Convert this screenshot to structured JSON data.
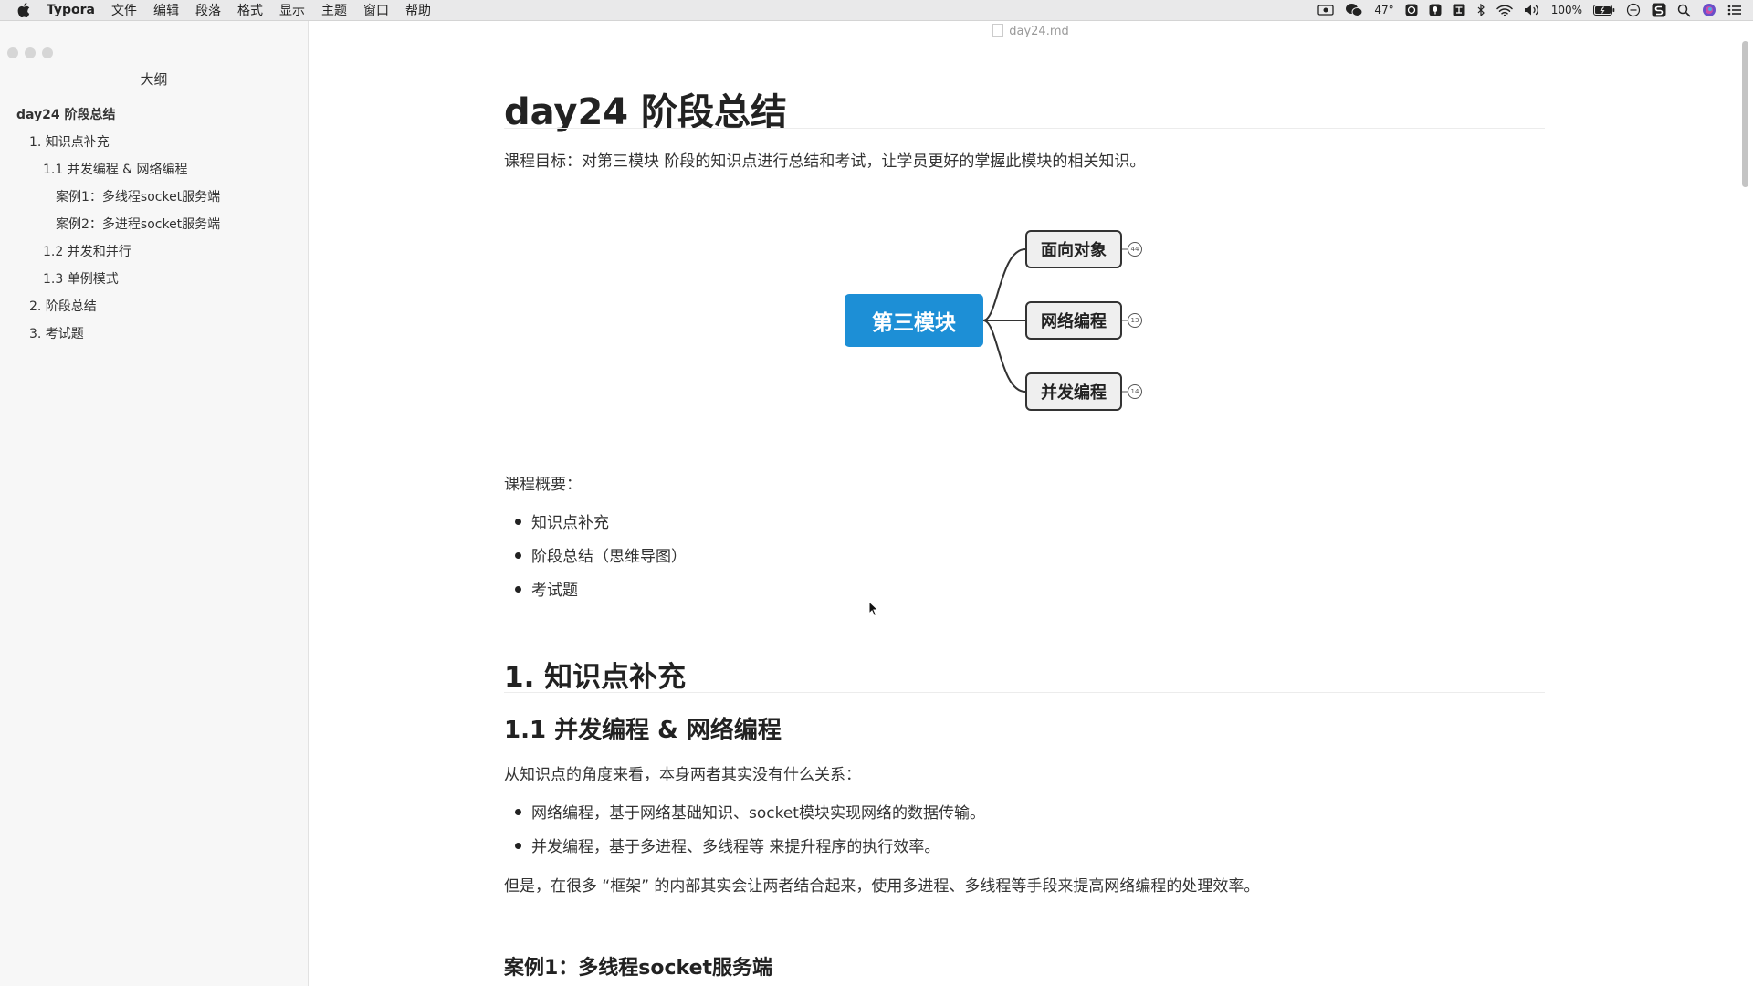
{
  "menubar": {
    "app_name": "Typora",
    "items": [
      "文件",
      "编辑",
      "段落",
      "格式",
      "显示",
      "主题",
      "窗口",
      "帮助"
    ],
    "status": {
      "temperature": "47°",
      "battery": "100%"
    }
  },
  "window": {
    "file_name": "day24.md"
  },
  "sidebar": {
    "title": "大纲",
    "outline": [
      {
        "label": "day24 阶段总结",
        "level": 1
      },
      {
        "label": "1. 知识点补充",
        "level": 2
      },
      {
        "label": "1.1 并发编程 & 网络编程",
        "level": 3
      },
      {
        "label": "案例1：多线程socket服务端",
        "level": 4
      },
      {
        "label": "案例2：多进程socket服务端",
        "level": 4
      },
      {
        "label": "1.2 并发和并行",
        "level": 3
      },
      {
        "label": "1.3 单例模式",
        "level": 3
      },
      {
        "label": "2. 阶段总结",
        "level": 2
      },
      {
        "label": "3. 考试题",
        "level": 2
      }
    ]
  },
  "document": {
    "title": "day24 阶段总结",
    "goal": "课程目标：对第三模块 阶段的知识点进行总结和考试，让学员更好的掌握此模块的相关知识。",
    "mindmap": {
      "root": "第三模块",
      "children": [
        {
          "label": "面向对象",
          "badge": "44"
        },
        {
          "label": "网络编程",
          "badge": "13"
        },
        {
          "label": "并发编程",
          "badge": "14"
        }
      ]
    },
    "overview_label": "课程概要：",
    "overview_items": [
      "知识点补充",
      "阶段总结（思维导图）",
      "考试题"
    ],
    "section1_title": "1. 知识点补充",
    "section11_title": "1.1 并发编程 & 网络编程",
    "section11_intro": "从知识点的角度来看，本身两者其实没有什么关系：",
    "section11_items": [
      "网络编程，基于网络基础知识、socket模块实现网络的数据传输。",
      "并发编程，基于多进程、多线程等 来提升程序的执行效率。"
    ],
    "section11_note": "但是，在很多 “框架” 的内部其实会让两者结合起来，使用多进程、多线程等手段来提高网络编程的处理效率。",
    "case1_title": "案例1：多线程socket服务端"
  }
}
